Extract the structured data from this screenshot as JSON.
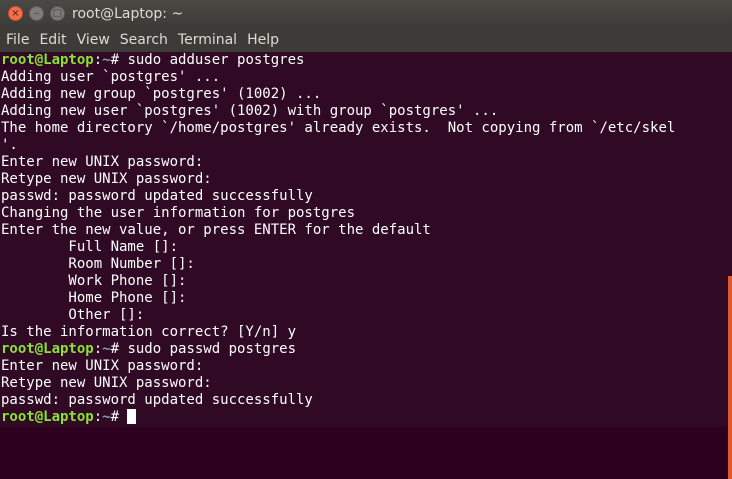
{
  "window": {
    "title": "root@Laptop: ~",
    "close_glyph": "×",
    "minimize_glyph": "–",
    "maximize_glyph": "□"
  },
  "menu": [
    "File",
    "Edit",
    "View",
    "Search",
    "Terminal",
    "Help"
  ],
  "prompt": {
    "user_host": "root@Laptop",
    "sep": ":",
    "path": "~",
    "suffix": "# "
  },
  "terminal_lines": [
    {
      "prompt": true,
      "text": "sudo adduser postgres"
    },
    {
      "text": "Adding user `postgres' ..."
    },
    {
      "text": "Adding new group `postgres' (1002) ..."
    },
    {
      "text": "Adding new user `postgres' (1002) with group `postgres' ..."
    },
    {
      "text": "The home directory `/home/postgres' already exists.  Not copying from `/etc/skel"
    },
    {
      "text": "'."
    },
    {
      "text": "Enter new UNIX password:"
    },
    {
      "text": "Retype new UNIX password:"
    },
    {
      "text": "passwd: password updated successfully"
    },
    {
      "text": "Changing the user information for postgres"
    },
    {
      "text": "Enter the new value, or press ENTER for the default"
    },
    {
      "text": "        Full Name []:"
    },
    {
      "text": "        Room Number []:"
    },
    {
      "text": "        Work Phone []:"
    },
    {
      "text": "        Home Phone []:"
    },
    {
      "text": "        Other []:"
    },
    {
      "text": "Is the information correct? [Y/n] y"
    },
    {
      "prompt": true,
      "text": "sudo passwd postgres"
    },
    {
      "text": "Enter new UNIX password:"
    },
    {
      "text": "Retype new UNIX password:"
    },
    {
      "text": "passwd: password updated successfully"
    },
    {
      "prompt": true,
      "text": "",
      "cursor": true
    }
  ],
  "colors": {
    "background": "#300a24",
    "prompt_user": "#8ae234",
    "prompt_path": "#729fcf",
    "scrollbar": "#e0592c"
  }
}
